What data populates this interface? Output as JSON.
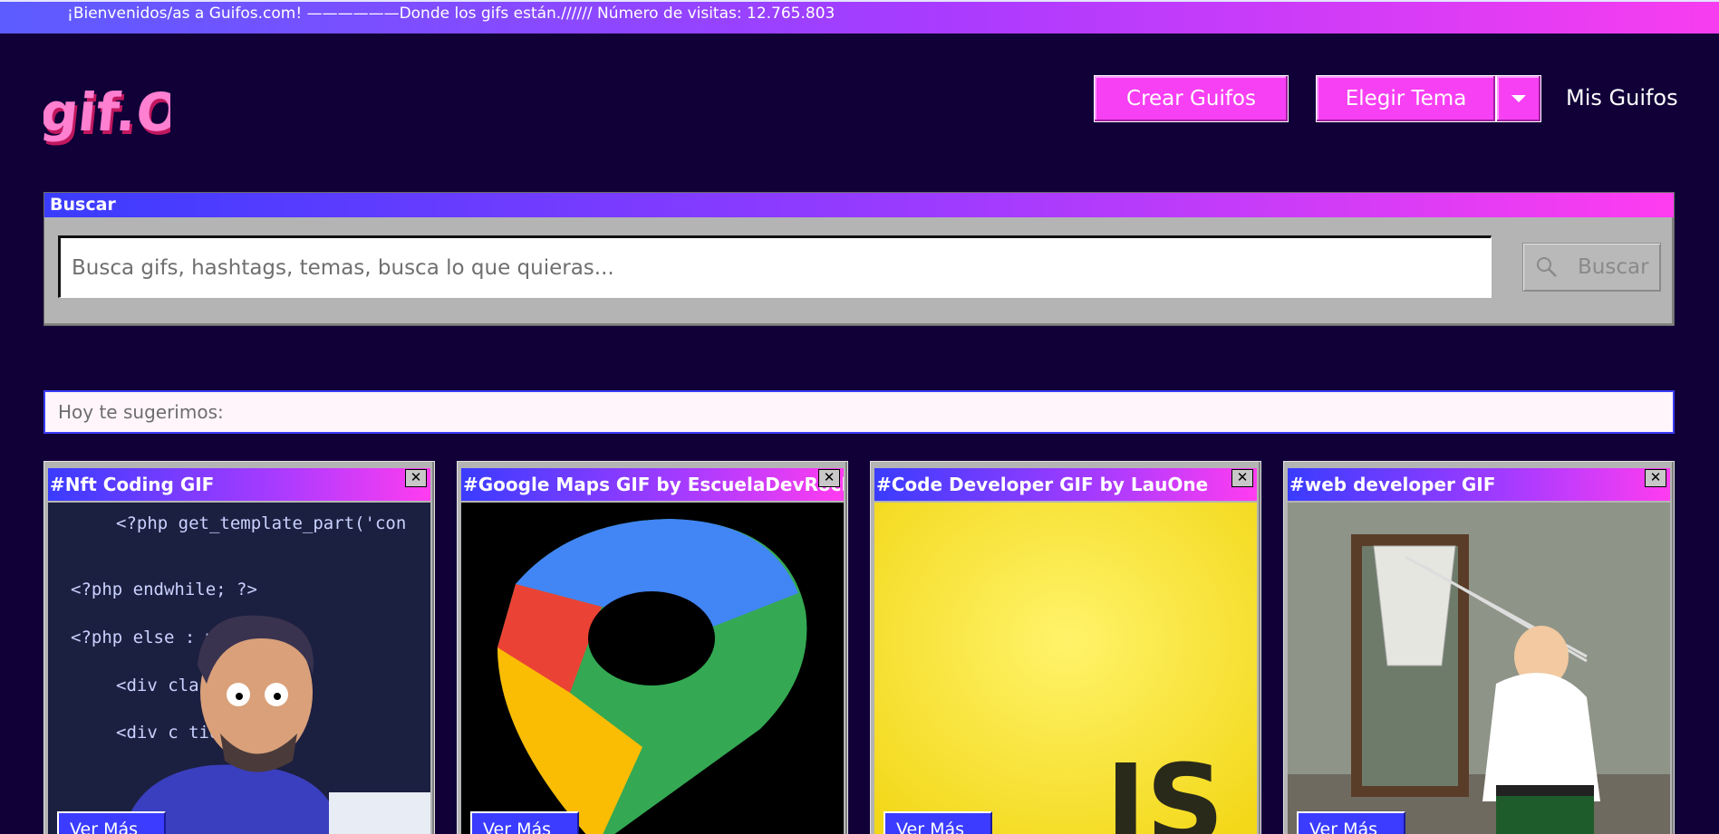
{
  "topbar": {
    "text": "¡Bienvenidos/as a Guifos.com! ——————Donde los gifs están.////// Número de visitas: 12.765.803"
  },
  "header": {
    "logo_text": "gif.OS",
    "crear_label": "Crear Guifos",
    "elegir_label": "Elegir Tema",
    "mis_guifos_label": "Mis Guifos"
  },
  "search": {
    "title": "Buscar",
    "placeholder": "Busca gifs, hashtags, temas, busca lo que quieras...",
    "button_label": "Buscar",
    "button_icon": "search-icon"
  },
  "suggest": {
    "label": "Hoy te sugerimos:"
  },
  "cards": [
    {
      "title": "#Nft Coding GIF",
      "button": "Ver Más",
      "close": "✕"
    },
    {
      "title": "#Google Maps GIF by EscuelaDevRock",
      "button": "Ver Más",
      "close": "✕"
    },
    {
      "title": "#Code Developer GIF by LauOne",
      "button": "Ver Más",
      "close": "✕"
    },
    {
      "title": "#web developer GIF",
      "button": "Ver Más",
      "close": "✕"
    }
  ],
  "code_lines": [
    "<?php get_template_part('con",
    "<?php endwhile; ?>",
    "<?php else :        mplate()",
    "<div cla        r\">",
    "<div c       tion justi"
  ],
  "js_label": "JS",
  "colors": {
    "background": "#110038",
    "accent_pink": "#f73ff3",
    "accent_blue": "#3b3cff",
    "panel_gray": "#b4b4b4"
  }
}
